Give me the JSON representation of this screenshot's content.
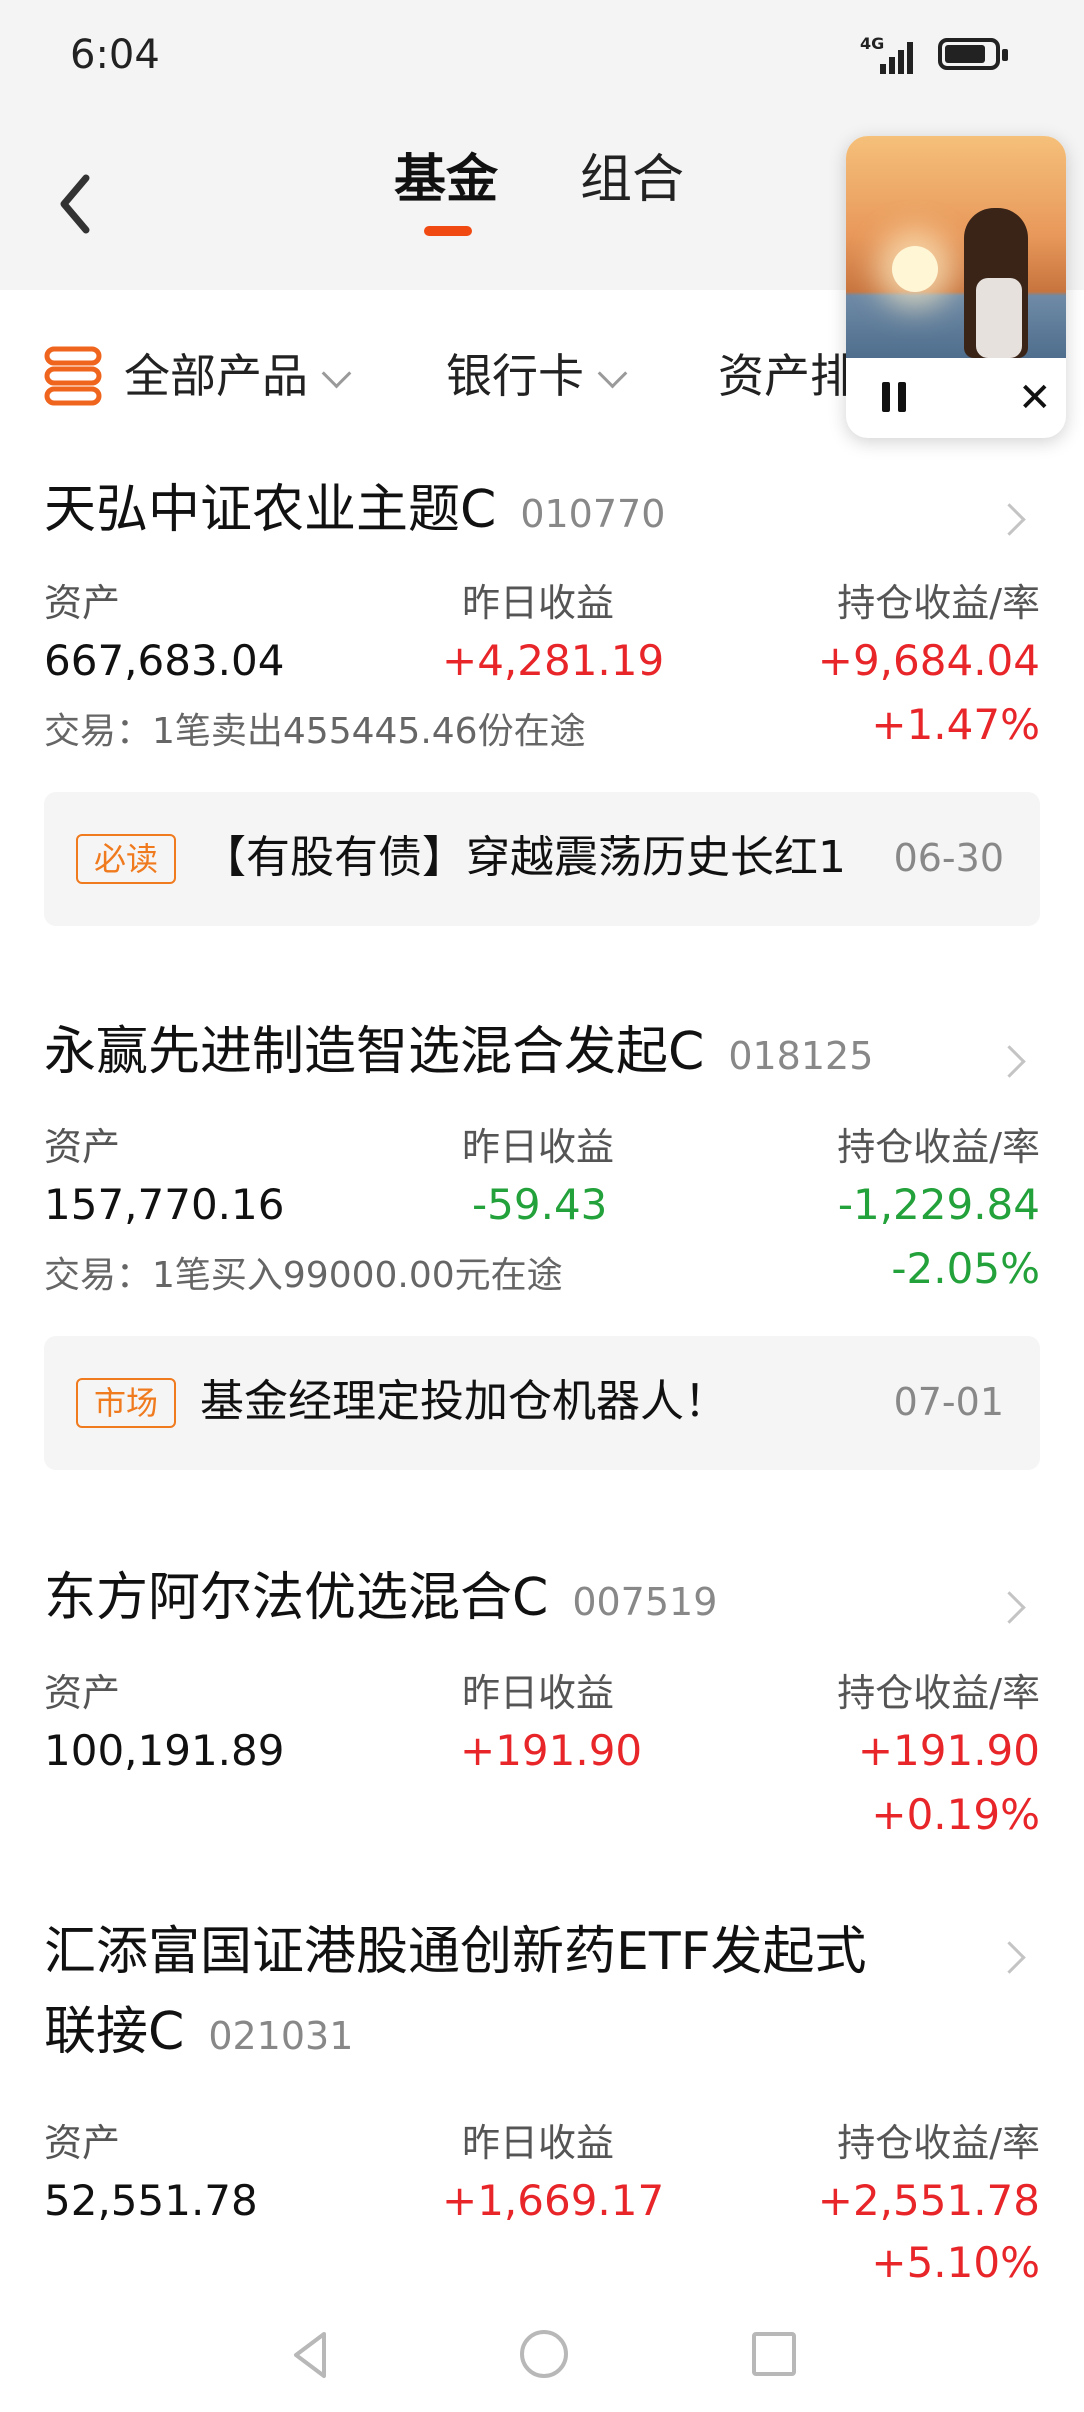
{
  "status": {
    "time": "6:04",
    "network": "4G"
  },
  "nav": {
    "tabs": [
      {
        "label": "基金"
      },
      {
        "label": "组合"
      }
    ]
  },
  "filters": [
    {
      "label": "全部产品"
    },
    {
      "label": "银行卡"
    },
    {
      "label": "资产排"
    }
  ],
  "funds": [
    {
      "name": "天弘中证农业主题C",
      "code": "010770",
      "labels": {
        "asset": "资产",
        "yesterday": "昨日收益",
        "holding": "持仓收益/率"
      },
      "asset": "667,683.04",
      "yesterday": "+4,281.19",
      "holding": "+9,684.04",
      "rate": "+1.47%",
      "trade": "交易：1笔卖出455445.46份在途",
      "notice": {
        "tag": "必读",
        "text": "【有股有债】穿越震荡历史长红1",
        "date": "06-30"
      }
    },
    {
      "name": "永赢先进制造智选混合发起C",
      "code": "018125",
      "labels": {
        "asset": "资产",
        "yesterday": "昨日收益",
        "holding": "持仓收益/率"
      },
      "asset": "157,770.16",
      "yesterday": "-59.43",
      "holding": "-1,229.84",
      "rate": "-2.05%",
      "trade": "交易：1笔买入99000.00元在途",
      "notice": {
        "tag": "市场",
        "text": "基金经理定投加仓机器人！",
        "date": "07-01"
      }
    },
    {
      "name": "东方阿尔法优选混合C",
      "code": "007519",
      "labels": {
        "asset": "资产",
        "yesterday": "昨日收益",
        "holding": "持仓收益/率"
      },
      "asset": "100,191.89",
      "yesterday": "+191.90",
      "holding": "+191.90",
      "rate": "+0.19%"
    },
    {
      "name_line1": "汇添富国证港股通创新药ETF发起式",
      "name_line2": "联接C",
      "code": "021031",
      "labels": {
        "asset": "资产",
        "yesterday": "昨日收益",
        "holding": "持仓收益/率"
      },
      "asset": "52,551.78",
      "yesterday": "+1,669.17",
      "holding": "+2,551.78",
      "rate": "+5.10%"
    }
  ],
  "colors": {
    "accent": "#f04a12",
    "gain": "#e8262a",
    "loss": "#23a13a",
    "tag": "#f07a1e"
  },
  "icons": {
    "back": "chevron-left-icon",
    "menu": "stack-list-icon",
    "pause": "pause-icon",
    "close": "close-icon"
  }
}
